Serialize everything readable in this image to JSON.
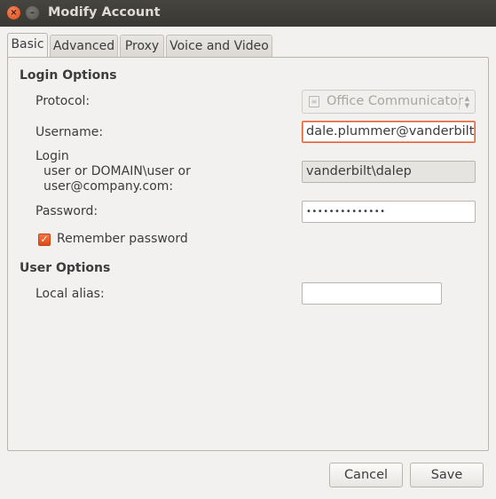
{
  "window": {
    "title": "Modify Account",
    "close_glyph": "×",
    "minimize_glyph": "–"
  },
  "tabs": [
    {
      "label": "Basic",
      "active": true
    },
    {
      "label": "Advanced",
      "active": false
    },
    {
      "label": "Proxy",
      "active": false
    },
    {
      "label": "Voice and Video",
      "active": false
    }
  ],
  "login_options": {
    "heading": "Login Options",
    "protocol": {
      "label": "Protocol:",
      "value": "Office Communicator",
      "icon": "protocol-icon"
    },
    "username": {
      "label": "Username:",
      "value": "dale.plummer@vanderbilt.edu"
    },
    "login": {
      "label_line1": "Login",
      "label_line2": "user  or  DOMAIN\\user  or",
      "label_line3": "user@company.com:",
      "value": "vanderbilt\\dalep"
    },
    "password": {
      "label": "Password:",
      "value": "••••••••••••••"
    },
    "remember": {
      "label": "Remember password",
      "checked": true,
      "check_glyph": "✓"
    }
  },
  "user_options": {
    "heading": "User Options",
    "local_alias": {
      "label": "Local alias:",
      "value": ""
    }
  },
  "buttons": {
    "cancel": "Cancel",
    "save": "Save"
  },
  "colors": {
    "accent": "#e45d31",
    "titlebar": "#3c3b37",
    "window_bg": "#f2f1f0"
  }
}
